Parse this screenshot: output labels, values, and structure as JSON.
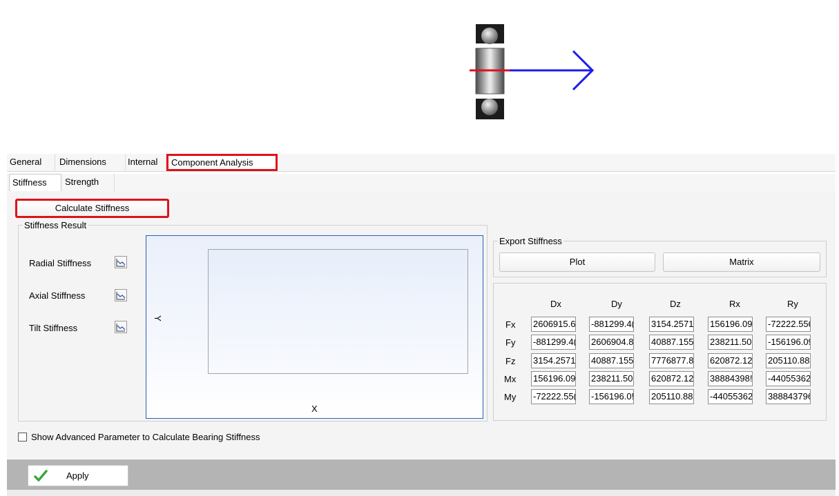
{
  "tabs": [
    "General",
    "Dimensions",
    "Internal",
    "Component Analysis"
  ],
  "subtabs": [
    "Stiffness",
    "Strength"
  ],
  "calculate_button": "Calculate Stiffness",
  "result_group": {
    "title": "Stiffness Result",
    "items": [
      "Radial Stiffness",
      "Axial Stiffness",
      "Tilt Stiffness"
    ]
  },
  "plot": {
    "y_label": "Y",
    "x_label": "X"
  },
  "export": {
    "title": "Export Stiffness",
    "plot_button": "Plot",
    "matrix_button": "Matrix"
  },
  "matrix": {
    "columns": [
      "Dx",
      "Dy",
      "Dz",
      "Rx",
      "Ry"
    ],
    "rows": [
      {
        "label": "Fx",
        "values": [
          "2606915.6",
          "-881299.4(",
          "3154.2571",
          "156196.09",
          "-72222.556"
        ]
      },
      {
        "label": "Fy",
        "values": [
          "-881299.4(",
          "2606904.8",
          "40887.155",
          "238211.50",
          "-156196.09"
        ]
      },
      {
        "label": "Fz",
        "values": [
          "3154.2571",
          "40887.155",
          "7776877.8",
          "620872.12",
          "205110.88!"
        ]
      },
      {
        "label": "Mx",
        "values": [
          "156196.09",
          "238211.50",
          "620872.12",
          "38884398!",
          "-44055362"
        ]
      },
      {
        "label": "My",
        "values": [
          "-72222.55(",
          "-156196.0!",
          "205110.88",
          "-44055362",
          "388843796"
        ]
      }
    ]
  },
  "advanced_checkbox": "Show Advanced Parameter to Calculate Bearing Stiffness",
  "apply_button": "Apply",
  "colors": {
    "highlight": "#e0111b",
    "arrow": "#1a1aee",
    "shaft": "#e01020",
    "plot_border": "#2a5fb0",
    "check": "#3aa83a"
  }
}
